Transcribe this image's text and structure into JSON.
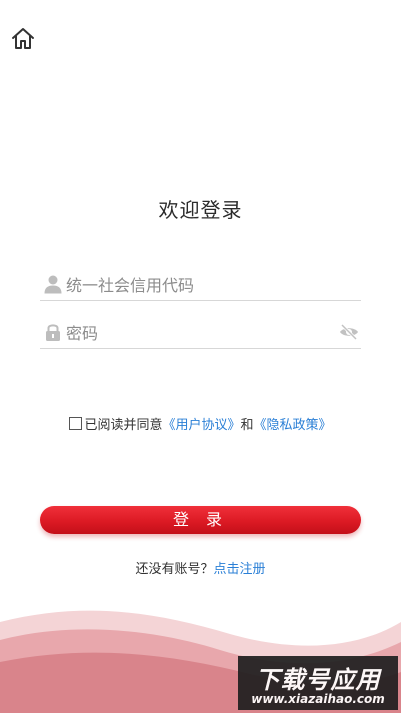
{
  "header": {
    "home_icon": "home-icon"
  },
  "login": {
    "title": "欢迎登录",
    "username": {
      "placeholder": "统一社会信用代码",
      "value": "",
      "icon": "person-icon"
    },
    "password": {
      "placeholder": "密码",
      "value": "",
      "icon": "lock-icon",
      "toggle_icon": "eye-off-icon"
    },
    "agreement": {
      "checked": false,
      "prefix": "已阅读并同意",
      "user_agreement": "《用户协议》",
      "conjunction": "和",
      "privacy_policy": "《隐私政策》"
    },
    "submit_label": "登 录",
    "register": {
      "prompt": "还没有账号？",
      "link": "点击注册"
    }
  },
  "watermark": {
    "title": "下载号应用",
    "url": "www.xiazaihao.com"
  },
  "colors": {
    "accent_red": "#dc1a24",
    "link_blue": "#2a7fd6",
    "wave_light": "#f2c9cc",
    "wave_dark": "#d9848b"
  }
}
